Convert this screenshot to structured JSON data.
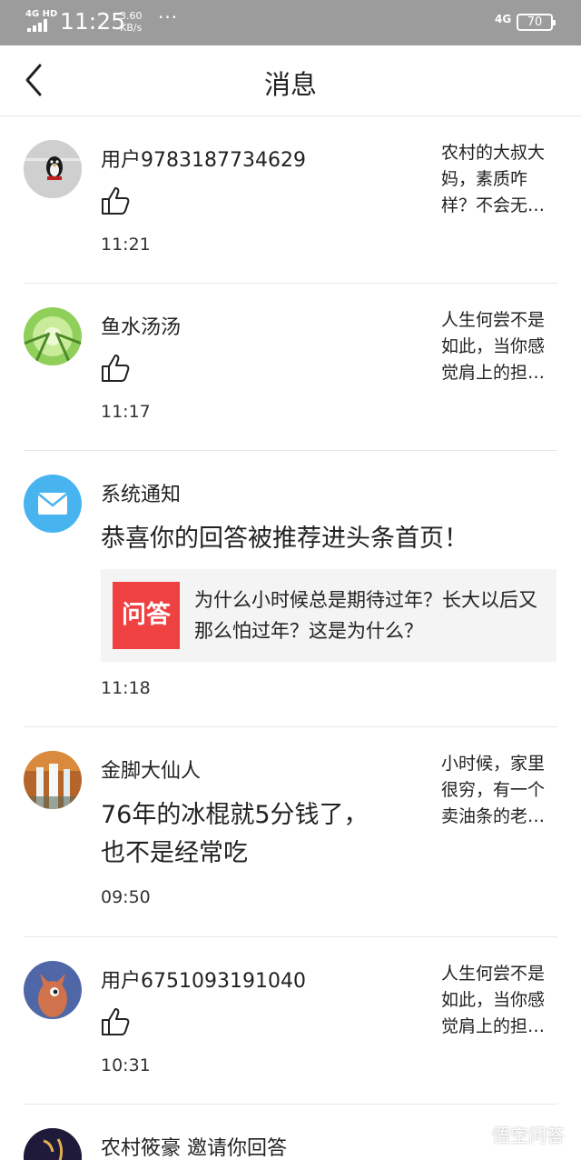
{
  "status_bar": {
    "network": "4G HD",
    "time": "11:25",
    "speed_value": "3.60",
    "speed_unit": "KB/s",
    "dots": "···",
    "network_right": "4G",
    "battery": "70"
  },
  "header": {
    "title": "消息"
  },
  "messages": [
    {
      "name": "用户9783187734629",
      "time": "11:21",
      "quote": [
        "农村的大叔大",
        "妈，素质咋",
        "样？不会无…"
      ]
    },
    {
      "name": "鱼水汤汤",
      "time": "11:17",
      "quote": [
        "人生何尝不是",
        "如此，当你感",
        "觉肩上的担…"
      ]
    },
    {
      "name": "系统通知",
      "text": "恭喜你的回答被推荐进头条首页！",
      "card_logo": "问答",
      "card_text": "为什么小时候总是期待过年？长大以后又那么怕过年？这是为什么？",
      "time": "11:18"
    },
    {
      "name": "金脚大仙人",
      "text": [
        "76年的冰棍就5分钱了，",
        "也不是经常吃"
      ],
      "time": "09:50",
      "quote": [
        "小时候，家里",
        "很穷，有一个",
        "卖油条的老…"
      ]
    },
    {
      "name": "用户6751093191040",
      "time": "10:31",
      "quote": [
        "人生何尝不是",
        "如此，当你感",
        "觉肩上的担…"
      ]
    },
    {
      "name": "农村筱豪  邀请你回答"
    }
  ],
  "watermark": "悟空问答",
  "colors": {
    "status_bar": "#9c9c9c",
    "card_logo": "#f04142",
    "mail_avatar": "#47b4f0"
  }
}
